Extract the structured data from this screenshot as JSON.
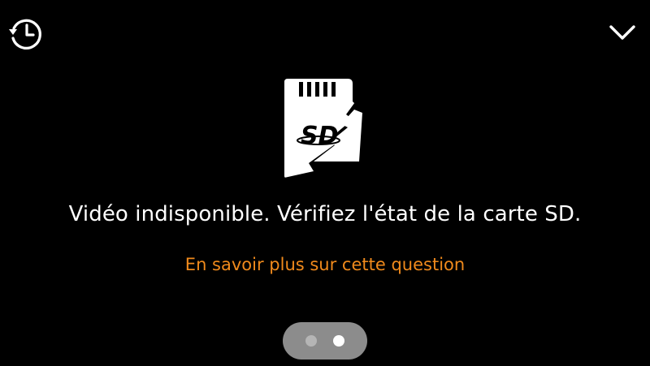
{
  "icons": {
    "history": "history-clock-icon",
    "collapse": "chevron-down-icon",
    "sd_card": "sd-card-broken-icon"
  },
  "sd_card": {
    "label": "SD"
  },
  "message": {
    "text": "Vidéo indisponible. Vérifiez l'état de la carte SD."
  },
  "link": {
    "text": "En savoir plus sur cette question"
  },
  "pager": {
    "count": 2,
    "active_index": 1
  },
  "colors": {
    "background": "#000000",
    "text": "#ffffff",
    "link": "#f08a1c",
    "pager_bg": "#8c8c8c",
    "dot_inactive": "#b5b5b5",
    "dot_active": "#ffffff"
  }
}
